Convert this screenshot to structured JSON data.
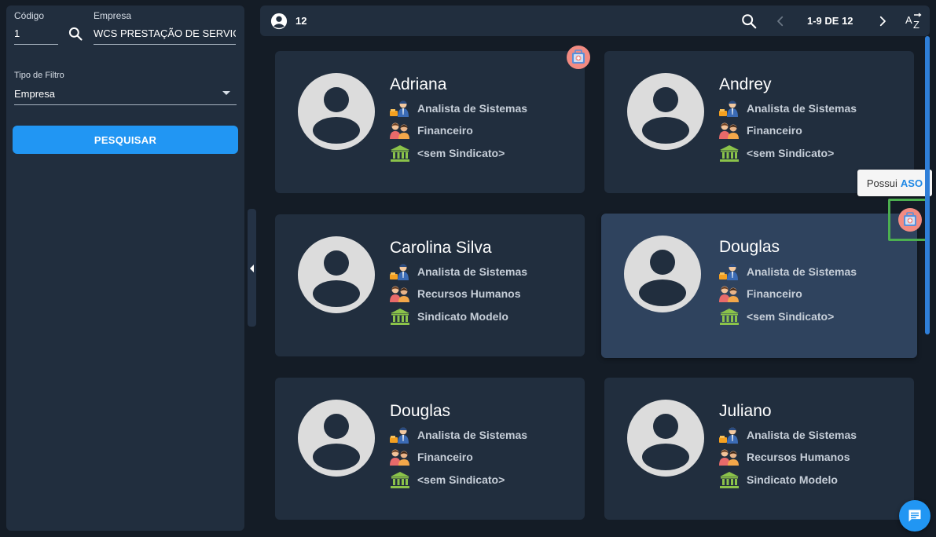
{
  "filters": {
    "codigo_label": "Código",
    "codigo_value": "1",
    "empresa_label": "Empresa",
    "empresa_value": "WCS PRESTAÇÃO DE SERVIÇOS",
    "tipo_label": "Tipo de Filtro",
    "tipo_value": "Empresa",
    "search_button": "PESQUISAR"
  },
  "topbar": {
    "count": "12",
    "pagination": "1-9 DE 12"
  },
  "tooltip": {
    "prefix": "Possui",
    "highlight": "ASO"
  },
  "cards": [
    {
      "name": "Adriana",
      "role": "Analista de Sistemas",
      "department": "Financeiro",
      "union": "<sem Sindicato>"
    },
    {
      "name": "Andrey",
      "role": "Analista de Sistemas",
      "department": "Financeiro",
      "union": "<sem Sindicato>"
    },
    {
      "name": "Carolina Silva",
      "role": "Analista de Sistemas",
      "department": "Recursos Humanos",
      "union": "Sindicato Modelo"
    },
    {
      "name": "Douglas",
      "role": "Analista de Sistemas",
      "department": "Financeiro",
      "union": "<sem Sindicato>"
    },
    {
      "name": "Douglas",
      "role": "Analista de Sistemas",
      "department": "Financeiro",
      "union": "<sem Sindicato>"
    },
    {
      "name": "Juliano",
      "role": "Analista de Sistemas",
      "department": "Recursos Humanos",
      "union": "Sindicato Modelo"
    }
  ],
  "icons": {
    "user": "account-circle-icon",
    "search": "search-icon",
    "prev": "chevron-left-icon",
    "next": "chevron-right-icon",
    "sort": "sort-alpha-icon",
    "role": "worker-icon",
    "department": "people-group-icon",
    "union": "bank-building-icon",
    "aso": "medical-kit-icon",
    "chat": "chat-icon"
  },
  "colors": {
    "accent": "#2196f3",
    "panel": "#212e3e",
    "background": "#141c26",
    "highlight_card": "#2f435e",
    "selection_box": "#4caf50"
  }
}
